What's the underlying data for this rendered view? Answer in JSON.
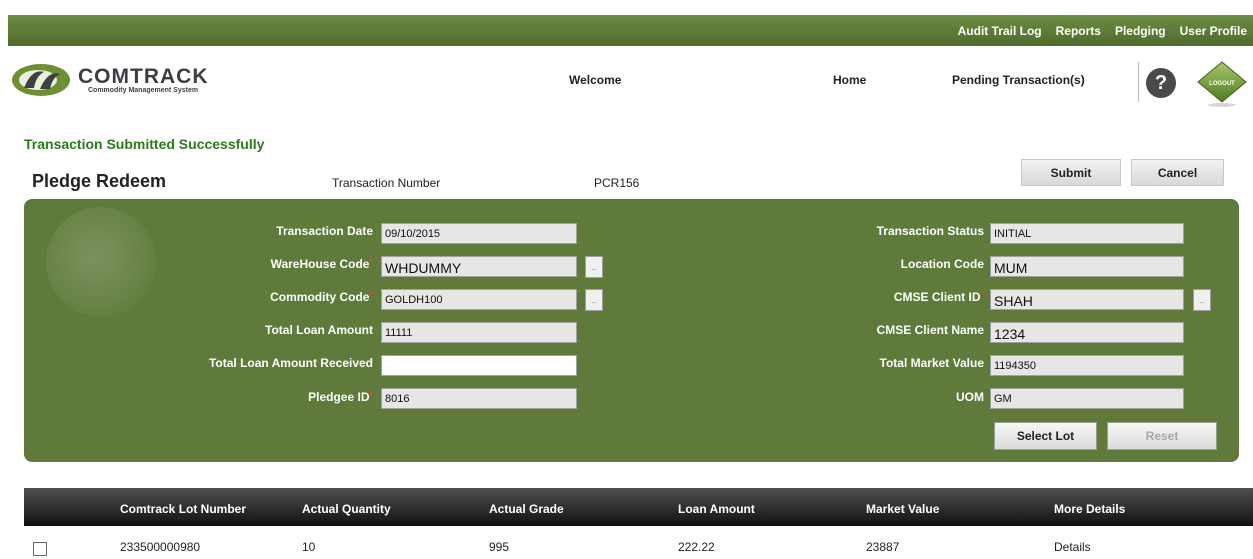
{
  "topnav": [
    "Audit Trail Log",
    "Reports",
    "Pledging",
    "User Profile"
  ],
  "header": {
    "logo_name": "COMTRACK",
    "logo_tagline": "Commodity Management System",
    "welcome": "Welcome",
    "home": "Home",
    "pending": "Pending Transaction(s)",
    "help_glyph": "?",
    "logout_label": "LOGOUT"
  },
  "message": "Transaction Submitted Successfully",
  "page": {
    "title": "Pledge Redeem",
    "txn_number_label": "Transaction Number",
    "txn_number_value": "PCR156"
  },
  "actions": {
    "submit": "Submit",
    "cancel": "Cancel"
  },
  "form": {
    "transaction_date": {
      "label": "Transaction Date",
      "value": "09/10/2015"
    },
    "warehouse_code": {
      "label": "WareHouse Code",
      "value": "WHDUMMY"
    },
    "commodity_code": {
      "label": "Commodity Code",
      "value": "GOLDH100"
    },
    "total_loan_amount": {
      "label": "Total Loan Amount",
      "value": "11111"
    },
    "total_loan_amount_received": {
      "label": "Total Loan Amount Received",
      "value": ""
    },
    "pledgee_id": {
      "label": "Pledgee ID",
      "value": "8016"
    },
    "transaction_status": {
      "label": "Transaction Status",
      "value": "INITIAL"
    },
    "location_code": {
      "label": "Location Code",
      "value": "MUM"
    },
    "cmse_client_id": {
      "label": "CMSE Client ID",
      "value": "SHAH"
    },
    "cmse_client_name": {
      "label": "CMSE Client Name",
      "value": "1234"
    },
    "total_market_value": {
      "label": "Total Market Value",
      "value": "1194350"
    },
    "uom": {
      "label": "UOM",
      "value": "GM"
    },
    "required_mark": "*",
    "lookup_glyph": "..",
    "select_lot": "Select Lot",
    "reset": "Reset"
  },
  "table": {
    "columns": [
      "Comtrack Lot Number",
      "Actual Quantity",
      "Actual Grade",
      "Loan Amount",
      "Market Value",
      "More Details"
    ],
    "rows": [
      [
        "233500000980",
        "10",
        "995",
        "222.22",
        "23887",
        "Details"
      ]
    ]
  },
  "colors": {
    "nav_green": "#5f7a34",
    "panel_green": "#5f7a3b",
    "success_green": "#2b7b1c",
    "required_red": "#e04040"
  }
}
